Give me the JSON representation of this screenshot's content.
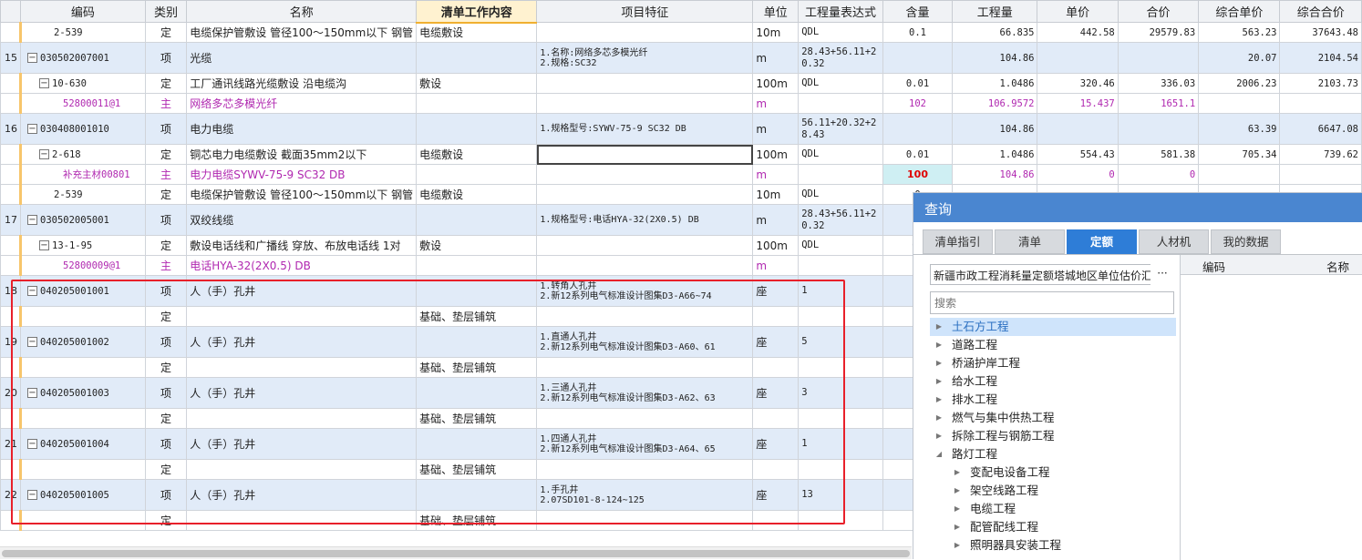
{
  "columns": [
    "编码",
    "类别",
    "名称",
    "清单工作内容",
    "项目特征",
    "单位",
    "工程量表达式",
    "含量",
    "工程量",
    "单价",
    "合价",
    "综合单价",
    "综合合价"
  ],
  "rows": [
    {
      "no": "",
      "code": "2-539",
      "level": 2,
      "toggle": "",
      "type": "定",
      "name": "电缆保护管敷设 管径100～150mm以下 钢管",
      "work": "电缆敷设",
      "feature": "",
      "unit": "10m",
      "expr": "QDL",
      "content": "0.1",
      "qty": "66.835",
      "price": "442.58",
      "total": "29579.83",
      "uprice": "563.23",
      "utotal": "37643.48",
      "style": "plain"
    },
    {
      "no": "15",
      "code": "030502007001",
      "level": 0,
      "toggle": "−",
      "type": "项",
      "name": "光缆",
      "work": "",
      "feature": "1.名称:网络多芯多模光纤\n2.规格:SC32",
      "unit": "m",
      "expr": "28.43+56.11+20.32",
      "content": "",
      "qty": "104.86",
      "price": "",
      "total": "",
      "uprice": "20.07",
      "utotal": "2104.54",
      "style": "blue"
    },
    {
      "no": "",
      "code": "10-630",
      "level": 1,
      "toggle": "−",
      "type": "定",
      "name": "工厂通讯线路光缆敷设 沿电缆沟",
      "work": "敷设",
      "feature": "",
      "unit": "100m",
      "expr": "QDL",
      "content": "0.01",
      "qty": "1.0486",
      "price": "320.46",
      "total": "336.03",
      "uprice": "2006.23",
      "utotal": "2103.73",
      "style": "plain"
    },
    {
      "no": "",
      "code": "52800011@1",
      "level": 2,
      "toggle": "",
      "type": "主",
      "name": "网络多芯多模光纤",
      "work": "",
      "feature": "",
      "unit": "m",
      "expr": "",
      "content": "102",
      "qty": "106.9572",
      "price": "15.437",
      "total": "1651.1",
      "uprice": "",
      "utotal": "",
      "style": "main"
    },
    {
      "no": "16",
      "code": "030408001010",
      "level": 0,
      "toggle": "−",
      "type": "项",
      "name": "电力电缆",
      "work": "",
      "feature": "1.规格型号:SYWV-75-9 SC32 DB",
      "unit": "m",
      "expr": "56.11+20.32+28.43",
      "content": "",
      "qty": "104.86",
      "price": "",
      "total": "",
      "uprice": "63.39",
      "utotal": "6647.08",
      "style": "blue"
    },
    {
      "no": "",
      "code": "2-618",
      "level": 1,
      "toggle": "−",
      "type": "定",
      "name": "铜芯电力电缆敷设 截面35mm2以下",
      "work": "电缆敷设",
      "feature": "",
      "unit": "100m",
      "expr": "QDL",
      "content": "0.01",
      "qty": "1.0486",
      "price": "554.43",
      "total": "581.38",
      "uprice": "705.34",
      "utotal": "739.62",
      "style": "plain",
      "selected": true
    },
    {
      "no": "",
      "code": "补充主材00801",
      "level": 2,
      "toggle": "",
      "type": "主",
      "name": "电力电缆SYWV-75-9 SC32 DB",
      "work": "",
      "feature": "",
      "unit": "m",
      "expr": "",
      "content": "100",
      "qty": "104.86",
      "price": "0",
      "total": "0",
      "uprice": "",
      "utotal": "",
      "style": "main",
      "editing": true
    },
    {
      "no": "",
      "code": "2-539",
      "level": 2,
      "toggle": "",
      "type": "定",
      "name": "电缆保护管敷设 管径100～150mm以下 钢管",
      "work": "电缆敷设",
      "feature": "",
      "unit": "10m",
      "expr": "QDL",
      "content": "0",
      "qty": "",
      "price": "",
      "total": "",
      "uprice": "",
      "utotal": "",
      "style": "plain"
    },
    {
      "no": "17",
      "code": "030502005001",
      "level": 0,
      "toggle": "−",
      "type": "项",
      "name": "双绞线缆",
      "work": "",
      "feature": "1.规格型号:电话HYA-32(2X0.5) DB",
      "unit": "m",
      "expr": "28.43+56.11+20.32",
      "content": "",
      "qty": "",
      "price": "",
      "total": "",
      "uprice": "",
      "utotal": "",
      "style": "blue"
    },
    {
      "no": "",
      "code": "13-1-95",
      "level": 1,
      "toggle": "−",
      "type": "定",
      "name": "敷设电话线和广播线 穿放、布放电话线 1对",
      "work": "敷设",
      "feature": "",
      "unit": "100m",
      "expr": "QDL",
      "content": "0.",
      "qty": "",
      "price": "",
      "total": "",
      "uprice": "",
      "utotal": "",
      "style": "plain"
    },
    {
      "no": "",
      "code": "52800009@1",
      "level": 2,
      "toggle": "",
      "type": "主",
      "name": "电话HYA-32(2X0.5) DB",
      "work": "",
      "feature": "",
      "unit": "m",
      "expr": "",
      "content": "1",
      "qty": "",
      "price": "",
      "total": "",
      "uprice": "",
      "utotal": "",
      "style": "main"
    },
    {
      "no": "18",
      "code": "040205001001",
      "level": 0,
      "toggle": "−",
      "type": "项",
      "name": "人（手）孔井",
      "work": "",
      "feature": "1.转角人孔井\n2.新12系列电气标准设计图集D3-A66~74",
      "unit": "座",
      "expr": "1",
      "content": "",
      "qty": "",
      "price": "",
      "total": "",
      "uprice": "",
      "utotal": "",
      "style": "blue"
    },
    {
      "no": "",
      "code": "",
      "level": 1,
      "toggle": "",
      "type": "定",
      "name": "",
      "work": "基础、垫层铺筑",
      "feature": "",
      "unit": "",
      "expr": "",
      "content": "",
      "qty": "",
      "price": "",
      "total": "",
      "uprice": "",
      "utotal": "",
      "style": "plain"
    },
    {
      "no": "19",
      "code": "040205001002",
      "level": 0,
      "toggle": "−",
      "type": "项",
      "name": "人（手）孔井",
      "work": "",
      "feature": "1.直通人孔井\n2.新12系列电气标准设计图集D3-A60、61",
      "unit": "座",
      "expr": "5",
      "content": "",
      "qty": "",
      "price": "",
      "total": "",
      "uprice": "",
      "utotal": "",
      "style": "blue"
    },
    {
      "no": "",
      "code": "",
      "level": 1,
      "toggle": "",
      "type": "定",
      "name": "",
      "work": "基础、垫层铺筑",
      "feature": "",
      "unit": "",
      "expr": "",
      "content": "",
      "qty": "",
      "price": "",
      "total": "",
      "uprice": "",
      "utotal": "",
      "style": "plain"
    },
    {
      "no": "20",
      "code": "040205001003",
      "level": 0,
      "toggle": "−",
      "type": "项",
      "name": "人（手）孔井",
      "work": "",
      "feature": "1.三通人孔井\n2.新12系列电气标准设计图集D3-A62、63",
      "unit": "座",
      "expr": "3",
      "content": "",
      "qty": "",
      "price": "",
      "total": "",
      "uprice": "",
      "utotal": "",
      "style": "blue"
    },
    {
      "no": "",
      "code": "",
      "level": 1,
      "toggle": "",
      "type": "定",
      "name": "",
      "work": "基础、垫层铺筑",
      "feature": "",
      "unit": "",
      "expr": "",
      "content": "",
      "qty": "",
      "price": "",
      "total": "",
      "uprice": "",
      "utotal": "",
      "style": "plain"
    },
    {
      "no": "21",
      "code": "040205001004",
      "level": 0,
      "toggle": "−",
      "type": "项",
      "name": "人（手）孔井",
      "work": "",
      "feature": "1.四通人孔井\n2.新12系列电气标准设计图集D3-A64、65",
      "unit": "座",
      "expr": "1",
      "content": "",
      "qty": "",
      "price": "",
      "total": "",
      "uprice": "",
      "utotal": "",
      "style": "blue"
    },
    {
      "no": "",
      "code": "",
      "level": 1,
      "toggle": "",
      "type": "定",
      "name": "",
      "work": "基础、垫层铺筑",
      "feature": "",
      "unit": "",
      "expr": "",
      "content": "",
      "qty": "",
      "price": "",
      "total": "",
      "uprice": "",
      "utotal": "",
      "style": "plain"
    },
    {
      "no": "22",
      "code": "040205001005",
      "level": 0,
      "toggle": "−",
      "type": "项",
      "name": "人（手）孔井",
      "work": "",
      "feature": "1.手孔井\n2.07SD101-8-124~125",
      "unit": "座",
      "expr": "13",
      "content": "",
      "qty": "",
      "price": "",
      "total": "",
      "uprice": "",
      "utotal": "",
      "style": "blue"
    },
    {
      "no": "",
      "code": "",
      "level": 1,
      "toggle": "",
      "type": "定",
      "name": "",
      "work": "基础、垫层铺筑",
      "feature": "",
      "unit": "",
      "expr": "",
      "content": "",
      "qty": "",
      "price": "",
      "total": "",
      "uprice": "",
      "utotal": "",
      "style": "plain"
    }
  ],
  "panel": {
    "title": "查询",
    "tabs": [
      "清单指引",
      "清单",
      "定额",
      "人材机",
      "我的数据"
    ],
    "active_tab": 2,
    "library": "新疆市政工程消耗量定额塔城地区单位估价汇",
    "library_button": "···",
    "search_placeholder": "搜索",
    "result_headers": [
      "编码",
      "名称"
    ],
    "tree": [
      {
        "label": "土石方工程",
        "depth": 0,
        "arrow": "▶",
        "selected": true
      },
      {
        "label": "道路工程",
        "depth": 0,
        "arrow": "▶"
      },
      {
        "label": "桥涵护岸工程",
        "depth": 0,
        "arrow": "▶"
      },
      {
        "label": "给水工程",
        "depth": 0,
        "arrow": "▶"
      },
      {
        "label": "排水工程",
        "depth": 0,
        "arrow": "▶"
      },
      {
        "label": "燃气与集中供热工程",
        "depth": 0,
        "arrow": "▶"
      },
      {
        "label": "拆除工程与钢筋工程",
        "depth": 0,
        "arrow": "▶"
      },
      {
        "label": "路灯工程",
        "depth": 0,
        "arrow": "◢"
      },
      {
        "label": "变配电设备工程",
        "depth": 1,
        "arrow": "▶"
      },
      {
        "label": "架空线路工程",
        "depth": 1,
        "arrow": "▶"
      },
      {
        "label": "电缆工程",
        "depth": 1,
        "arrow": "▶"
      },
      {
        "label": "配管配线工程",
        "depth": 1,
        "arrow": "▶"
      },
      {
        "label": "照明器具安装工程",
        "depth": 1,
        "arrow": "▶"
      }
    ]
  },
  "colors": {
    "accent": "#2e7dd7",
    "panel_title": "#4a86d0",
    "highlight_frame": "#e8202a",
    "main_material": "#b028b0",
    "row_blue": "#e1ebf8"
  }
}
